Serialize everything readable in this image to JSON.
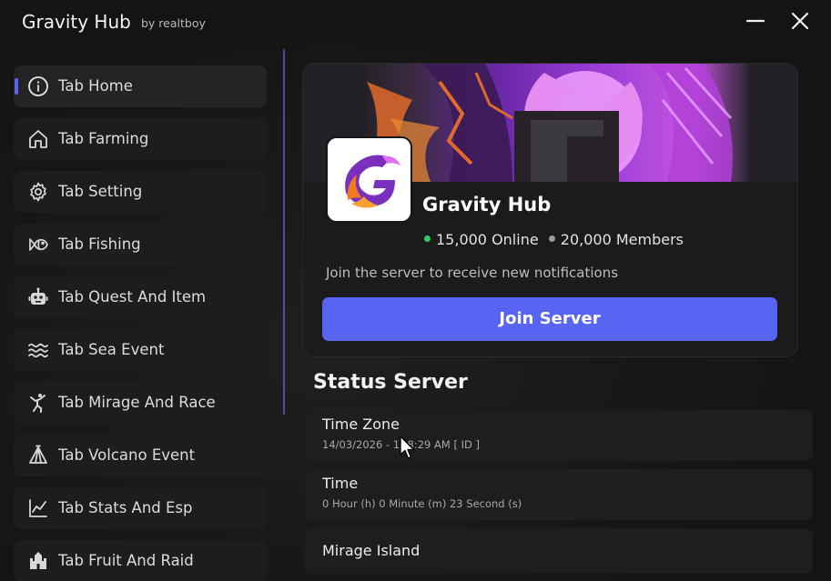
{
  "window": {
    "title": "Gravity Hub",
    "subtitle": "by realtboy",
    "minimize_icon": "minimize-icon",
    "close_icon": "close-icon"
  },
  "sidebar": {
    "accent_color": "#5b63f1",
    "items": [
      {
        "label": "Tab Home",
        "icon": "info-icon",
        "active": true
      },
      {
        "label": "Tab Farming",
        "icon": "home-icon",
        "active": false
      },
      {
        "label": "Tab Setting",
        "icon": "gear-icon",
        "active": false
      },
      {
        "label": "Tab Fishing",
        "icon": "fish-icon",
        "active": false
      },
      {
        "label": "Tab Quest And Item",
        "icon": "robot-icon",
        "active": false
      },
      {
        "label": "Tab Sea Event",
        "icon": "waves-icon",
        "active": false
      },
      {
        "label": "Tab Mirage And Race",
        "icon": "karate-icon",
        "active": false
      },
      {
        "label": "Tab Volcano Event",
        "icon": "tent-icon",
        "active": false
      },
      {
        "label": "Tab Stats And Esp",
        "icon": "chart-line-icon",
        "active": false
      },
      {
        "label": "Tab Fruit And Raid",
        "icon": "castle-icon",
        "active": false
      }
    ]
  },
  "server_card": {
    "name": "Gravity Hub",
    "online": "15,000 Online",
    "members": "20,000 Members",
    "invite_text": "Join the server to receive new notifications",
    "join_label": "Join Server",
    "join_color": "#5865f2",
    "online_color": "#33c96a"
  },
  "status": {
    "title": "Status Server",
    "rows": [
      {
        "title": "Time Zone",
        "value": "14/03/2026 - 1 28:29 AM [ ID ]"
      },
      {
        "title": "Time",
        "value": "0 Hour (h) 0 Minute (m) 23 Second (s)"
      },
      {
        "title": "Mirage Island",
        "value": ""
      }
    ]
  }
}
